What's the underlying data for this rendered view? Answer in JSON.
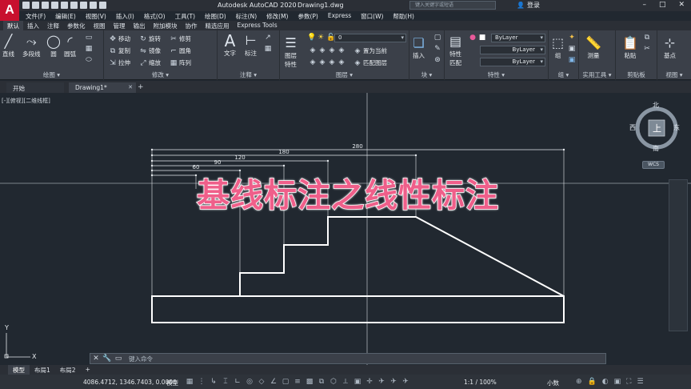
{
  "app": {
    "title": "Autodesk AutoCAD 2020",
    "document": "Drawing1.dwg",
    "logo_letter": "A",
    "search_placeholder": "键入关键字或短语",
    "login_label": "登录",
    "window_buttons": [
      "–",
      "□",
      "✕"
    ]
  },
  "menu": [
    "文件(F)",
    "编辑(E)",
    "视图(V)",
    "插入(I)",
    "格式(O)",
    "工具(T)",
    "绘图(D)",
    "标注(N)",
    "修改(M)",
    "参数(P)",
    "Express",
    "窗口(W)",
    "帮助(H)"
  ],
  "ribbon_tabs": [
    "默认",
    "插入",
    "注释",
    "参数化",
    "视图",
    "管理",
    "输出",
    "附加模块",
    "协作",
    "精选应用",
    "Express Tools"
  ],
  "ribbon": {
    "draw": {
      "title": "绘图 ▾",
      "buttons": [
        "直线",
        "多段线",
        "圆",
        "圆弧"
      ]
    },
    "modify": {
      "title": "修改 ▾",
      "rows": [
        "移动",
        "旋转",
        "修剪",
        "复制",
        "镜像",
        "圆角",
        "拉伸",
        "缩放",
        "阵列"
      ]
    },
    "annotation": {
      "title": "注释 ▾",
      "buttons": [
        "文字",
        "标注"
      ]
    },
    "layers": {
      "title": "图层 ▾",
      "props_button": "图层\n特性",
      "layer_value": "0",
      "set_current": "置为当前",
      "match_layer": "匹配图层"
    },
    "block": {
      "title": "块 ▾",
      "button": "插入"
    },
    "properties": {
      "title": "特性 ▾",
      "button": "特性\n匹配",
      "bylayer": [
        "ByLayer",
        "ByLayer",
        "ByLayer"
      ]
    },
    "groups": {
      "title": "组 ▾",
      "button": "组"
    },
    "utilities": {
      "title": "实用工具 ▾",
      "button": "测量"
    },
    "clipboard": {
      "title": "剪贴板",
      "button": "粘贴"
    },
    "view": {
      "title": "视图 ▾",
      "button": "基点"
    }
  },
  "doc_tabs": {
    "home": "开始",
    "active": "Drawing1*",
    "close": "✕",
    "plus": "+"
  },
  "viewport_label": "[-][俯视][二维线框]",
  "viewcube": {
    "north": "北",
    "south": "南",
    "east": "东",
    "west": "西",
    "top": "上",
    "wcs": "WCS"
  },
  "dimensions": [
    "280",
    "180",
    "120",
    "90",
    "60"
  ],
  "overlay_title": "基线标注之线性标注",
  "axis": {
    "y": "Y",
    "x": "X"
  },
  "command_prompt": "键入命令",
  "layout_tabs": [
    "模型",
    "布局1",
    "布局2"
  ],
  "status": {
    "coords": "4086.4712, 1346.7403, 0.0000",
    "model": "模型",
    "scale": "1:1 / 100%",
    "units": "小数"
  },
  "colors": {
    "canvas": "#212830",
    "ribbon": "#3b4049",
    "overlay_text": "#ef5f8a",
    "autocad_red": "#c8102e"
  }
}
